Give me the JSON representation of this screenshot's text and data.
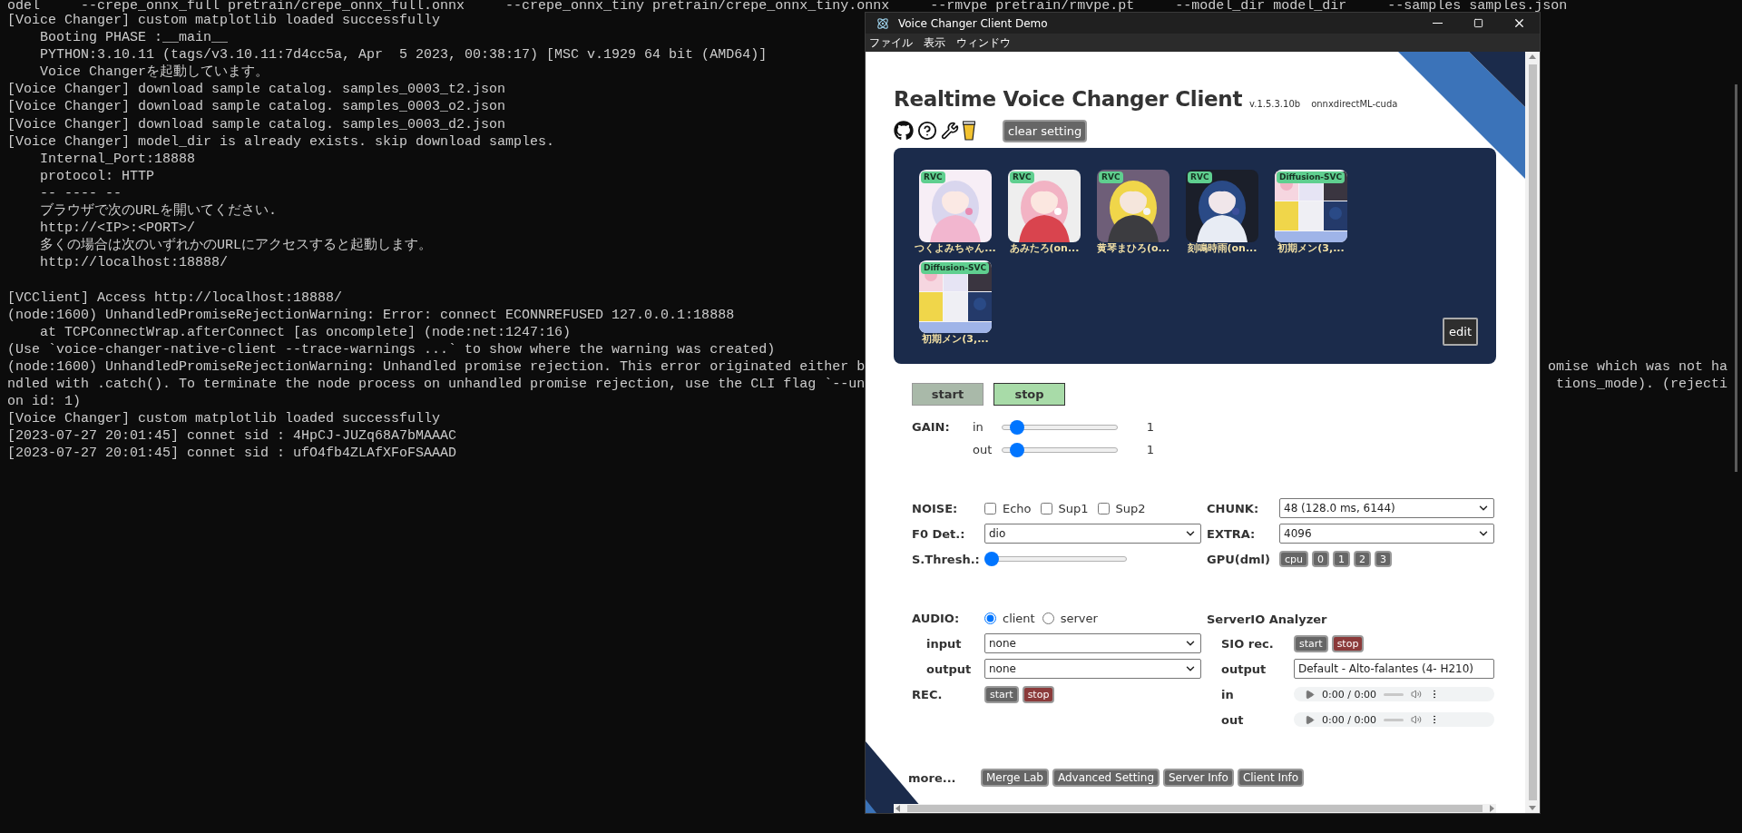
{
  "terminal": {
    "lines": [
      {
        "text": "odel     --crepe_onnx_full pretrain/crepe_onnx_full.onnx     --crepe_onnx_tiny pretrain/crepe_onnx_tiny.onnx     --rmvpe pretrain/rmvpe.pt     --model_dir model_dir     --samples samples.json"
      },
      {
        "text": "[Voice Changer] custom matplotlib loaded successfully"
      },
      {
        "text": "    Booting PHASE :__main__"
      },
      {
        "text": "    PYTHON:3.10.11 (tags/v3.10.11:7d4cc5a, Apr  5 2023, 00:38:17) [MSC v.1929 64 bit (AMD64)]"
      },
      {
        "text": "    Voice Changerを起動しています。"
      },
      {
        "text": "[Voice Changer] download sample catalog. samples_0003_t2.json"
      },
      {
        "text": "[Voice Changer] download sample catalog. samples_0003_o2.json"
      },
      {
        "text": "[Voice Changer] download sample catalog. samples_0003_d2.json"
      },
      {
        "text": "[Voice Changer] model_dir is already exists. skip download samples."
      },
      {
        "text": "    Internal_Port:18888"
      },
      {
        "text": "    protocol: HTTP"
      },
      {
        "text": "    -- ---- --"
      },
      {
        "text": "    ブラウザで次のURLを開いてください."
      },
      {
        "text": "    http://<IP>:<PORT>/"
      },
      {
        "text": "    多くの場合は次のいずれかのURLにアクセスすると起動します。"
      },
      {
        "text": "    http://localhost:18888/"
      },
      {
        "text": "[VCClient] Access http://localhost:18888/",
        "blank_before": true
      },
      {
        "text": "(node:1600) UnhandledPromiseRejectionWarning: Error: connect ECONNREFUSED 127.0.0.1:18888"
      },
      {
        "text": "    at TCPConnectWrap.afterConnect [as oncomplete] (node:net:1247:16)"
      },
      {
        "text": "(Use `voice-changer-native-client --trace-warnings ...` to show where the warning was created)"
      },
      {
        "text": "(node:1600) UnhandledPromiseRejectionWarning: Unhandled promise rejection. This error originated either b",
        "tail": "omise which was not ha"
      },
      {
        "text": "ndled with .catch(). To terminate the node process on unhandled promise rejection, use the CLI flag `--un",
        "tail": "tions_mode). (rejecti"
      },
      {
        "text": "on id: 1)"
      },
      {
        "text": "[Voice Changer] custom matplotlib loaded successfully"
      },
      {
        "text": "[2023-07-27 20:01:45] connet sid : 4HpCJ-JUZq68A7bMAAAC"
      },
      {
        "text": "[2023-07-27 20:01:45] connet sid : ufO4fb4ZLAfXFoFSAAAD"
      }
    ]
  },
  "window": {
    "title": "Voice Changer Client Demo",
    "menu": [
      "ファイル",
      "表示",
      "ウィンドウ"
    ]
  },
  "app": {
    "title": "Realtime Voice Changer Client",
    "version": "v.1.5.3.10b",
    "build": "onnxdirectML-cuda",
    "clear_button": "clear setting",
    "models": [
      {
        "badge": "RVC",
        "label": "つくよみちゃん...",
        "kind": "picture"
      },
      {
        "badge": "RVC",
        "label": "あみたろ(on...",
        "kind": "picture"
      },
      {
        "badge": "RVC",
        "label": "黄琴まひろ(o...",
        "kind": "picture"
      },
      {
        "badge": "RVC",
        "label": "刻鳴時雨(on...",
        "kind": "picture"
      },
      {
        "badge": "Diffusion-SVC",
        "label": "初期メン(3,...",
        "kind": "picture"
      },
      {
        "badge": "Diffusion-SVC",
        "label": "初期メン(3,...",
        "kind": "picture"
      }
    ],
    "edit_button": "edit",
    "server_buttons": [
      {
        "label": "start",
        "selected": false
      },
      {
        "label": "stop",
        "selected": true
      }
    ],
    "gain": {
      "label": "GAIN:",
      "channels": [
        {
          "name": "in",
          "level": 0.08,
          "reading": "1"
        },
        {
          "name": "out",
          "level": 0.08,
          "reading": "1"
        }
      ]
    },
    "noise": {
      "label": "NOISE:",
      "options": [
        {
          "label": "Echo",
          "checked": false
        },
        {
          "label": "Sup1",
          "checked": false
        },
        {
          "label": "Sup2",
          "checked": false
        }
      ]
    },
    "chunk": {
      "label": "CHUNK:",
      "value": "48 (128.0 ms, 6144)"
    },
    "f0": {
      "label": "F0 Det.:",
      "value": "dio"
    },
    "extra": {
      "label": "EXTRA:",
      "value": "4096"
    },
    "threshold": {
      "label": "S.Thresh.:",
      "level": 0
    },
    "gpu": {
      "label": "GPU(dml)",
      "options": [
        "cpu",
        "0",
        "1",
        "2",
        "3"
      ]
    },
    "audio": {
      "label": "AUDIO:",
      "modes": [
        {
          "label": "client",
          "selected": true
        },
        {
          "label": "server",
          "selected": false
        }
      ],
      "input": {
        "label": "input",
        "value": "none"
      },
      "output": {
        "label": "output",
        "value": "none"
      },
      "rec": {
        "label": "REC.",
        "buttons": [
          {
            "label": "start",
            "kind": "neutral"
          },
          {
            "label": "stop",
            "kind": "danger"
          }
        ]
      }
    },
    "analyzer": {
      "title": "ServerIO Analyzer",
      "sio": {
        "label": "SIO rec.",
        "buttons": [
          {
            "label": "start",
            "kind": "neutral"
          },
          {
            "label": "stop",
            "kind": "danger"
          }
        ]
      },
      "output": {
        "label": "output",
        "value": "Default - Alto-falantes (4- H210)"
      },
      "players": [
        {
          "label": "in",
          "time": "0:00 / 0:00"
        },
        {
          "label": "out",
          "time": "0:00 / 0:00"
        }
      ]
    },
    "more": {
      "label": "more...",
      "buttons": [
        "Merge Lab",
        "Advanced Setting",
        "Server Info",
        "Client Info"
      ]
    }
  }
}
